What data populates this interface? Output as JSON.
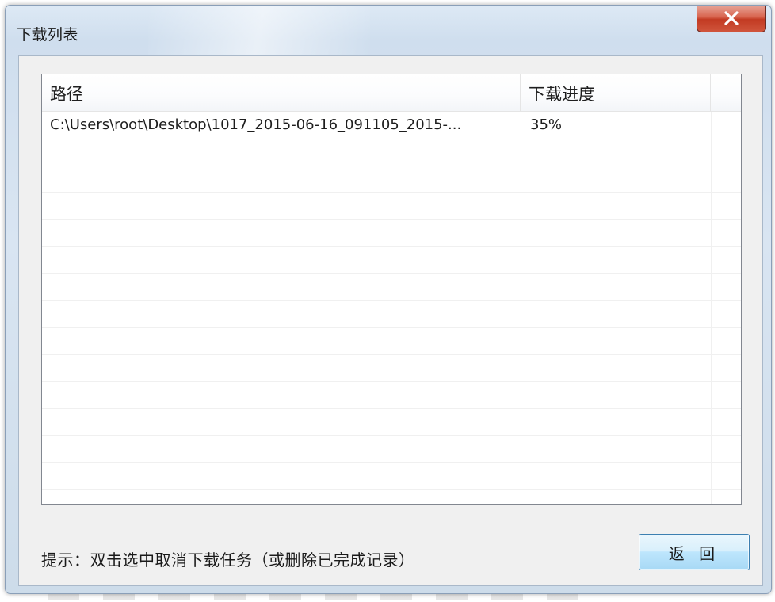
{
  "window": {
    "title": "下载列表"
  },
  "list": {
    "columns": [
      "路径",
      "下载进度"
    ],
    "rows": [
      {
        "path": "C:\\Users\\root\\Desktop\\1017_2015-06-16_091105_2015-...",
        "progress": "35%"
      }
    ],
    "empty_row_count": 13
  },
  "footer": {
    "hint": "提示：双击选中取消下载任务（或删除已完成记录）",
    "back_label": "返 回"
  },
  "colors": {
    "close_button": "#c8432b",
    "back_button_border": "#3c7fb1",
    "list_border": "#828790"
  },
  "icons": {
    "close": "close-x-icon"
  }
}
